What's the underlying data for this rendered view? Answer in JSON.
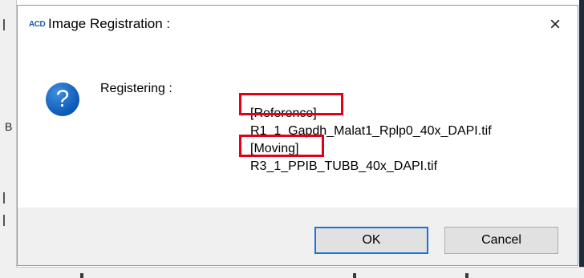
{
  "dialog": {
    "logo_text": "ACD",
    "title": "Image Registration :",
    "close_glyph": "×",
    "icon": "question-icon",
    "icon_glyph": "?",
    "registering_label": "Registering :",
    "reference_label": "[Reference]",
    "reference_file": "R1_1_Gapdh_Malat1_Rplp0_40x_DAPI.tif",
    "moving_label": "[Moving]",
    "moving_file": "R3_1_PPIB_TUBB_40x_DAPI.tif",
    "highlight_color": "#e0001a"
  },
  "buttons": {
    "ok_label": "OK",
    "cancel_label": "Cancel"
  },
  "background": {
    "left_letter": "B"
  }
}
